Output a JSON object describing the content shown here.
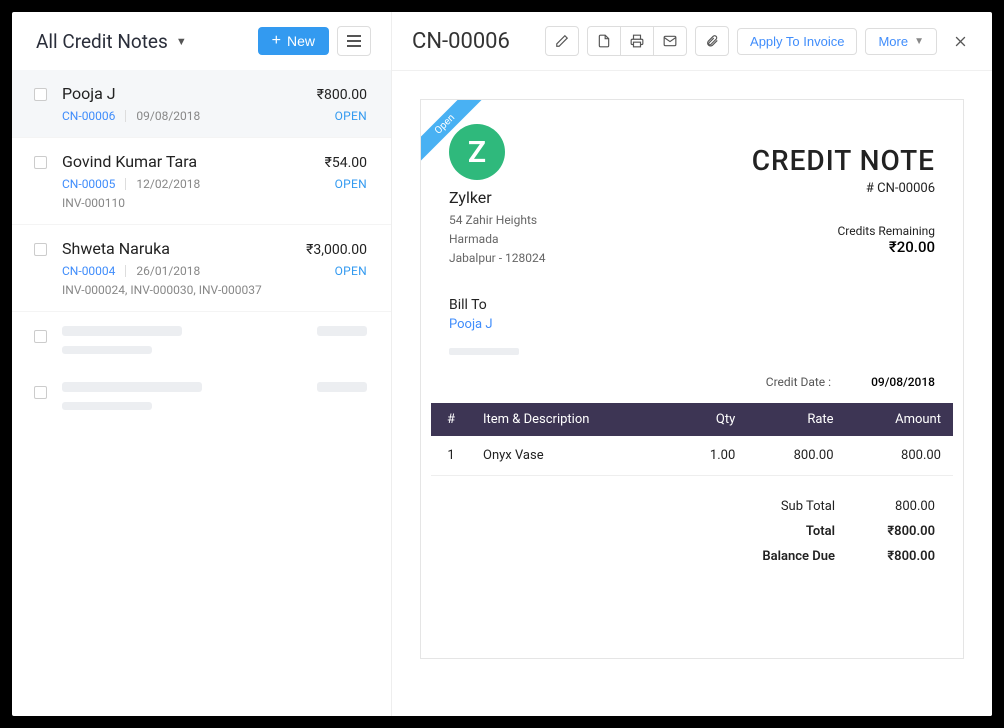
{
  "sidebar": {
    "filter_label": "All Credit Notes",
    "new_button": "New",
    "items": [
      {
        "name": "Pooja J",
        "amount": "₹800.00",
        "id": "CN-00006",
        "date": "09/08/2018",
        "status": "OPEN",
        "invoices": ""
      },
      {
        "name": "Govind Kumar Tara",
        "amount": "₹54.00",
        "id": "CN-00005",
        "date": "12/02/2018",
        "status": "OPEN",
        "invoices": "INV-000110"
      },
      {
        "name": "Shweta Naruka",
        "amount": "₹3,000.00",
        "id": "CN-00004",
        "date": "26/01/2018",
        "status": "OPEN",
        "invoices": "INV-000024, INV-000030, INV-000037"
      }
    ]
  },
  "header": {
    "title": "CN-00006",
    "apply_label": "Apply To Invoice",
    "more_label": "More"
  },
  "doc": {
    "ribbon": "Open",
    "logo_letter": "Z",
    "from": {
      "name": "Zylker",
      "line1": "54 Zahir Heights",
      "line2": "Harmada",
      "line3": "Jabalpur - 128024"
    },
    "title": "CREDIT NOTE",
    "number": "# CN-00006",
    "credits_label": "Credits Remaining",
    "credits_value": "₹20.00",
    "billto_label": "Bill To",
    "billto_name": "Pooja J",
    "credit_date_label": "Credit Date :",
    "credit_date_value": "09/08/2018",
    "th": {
      "idx": "#",
      "desc": "Item & Description",
      "qty": "Qty",
      "rate": "Rate",
      "amount": "Amount"
    },
    "items": [
      {
        "idx": "1",
        "desc": "Onyx Vase",
        "qty": "1.00",
        "rate": "800.00",
        "amount": "800.00"
      }
    ],
    "totals": {
      "subtotal_label": "Sub Total",
      "subtotal_value": "800.00",
      "total_label": "Total",
      "total_value": "₹800.00",
      "balance_label": "Balance Due",
      "balance_value": "₹800.00"
    }
  }
}
